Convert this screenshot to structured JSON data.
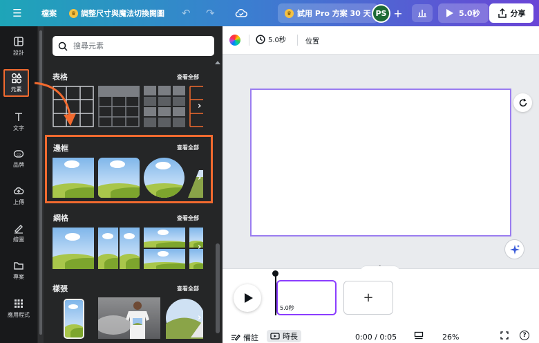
{
  "topbar": {
    "file_label": "檔案",
    "resize_label": "調整尺寸與魔法切換閱圖",
    "pro_label": "試用 Pro 方案 30 天",
    "avatar_initials": "PS",
    "play_label": "5.0秒",
    "share_label": "分享"
  },
  "rail": {
    "items": [
      {
        "label": "設計",
        "icon": "layout-icon"
      },
      {
        "label": "元素",
        "icon": "shapes-icon"
      },
      {
        "label": "文字",
        "icon": "text-icon"
      },
      {
        "label": "品牌",
        "icon": "brand-icon"
      },
      {
        "label": "上傳",
        "icon": "upload-icon"
      },
      {
        "label": "繪圖",
        "icon": "draw-icon"
      },
      {
        "label": "專案",
        "icon": "folder-icon"
      },
      {
        "label": "應用程式",
        "icon": "apps-icon"
      }
    ]
  },
  "panel": {
    "search_placeholder": "搜尋元素",
    "see_all": "查看全部",
    "sections": [
      {
        "title": "表格"
      },
      {
        "title": "邊框"
      },
      {
        "title": "網格"
      },
      {
        "title": "樣張"
      }
    ]
  },
  "subbar": {
    "duration_label": "5.0秒",
    "position_label": "位置"
  },
  "timeline": {
    "clip_duration": "5.0秒",
    "add_label": "+"
  },
  "bottombar": {
    "notes_label": "備註",
    "duration_label": "時長",
    "time_readout": "0:00 / 0:05",
    "zoom": "26%",
    "help": "?"
  },
  "colors": {
    "accent": "#8b3dff",
    "annotation": "#f26a2f",
    "panel_bg": "#252627"
  }
}
